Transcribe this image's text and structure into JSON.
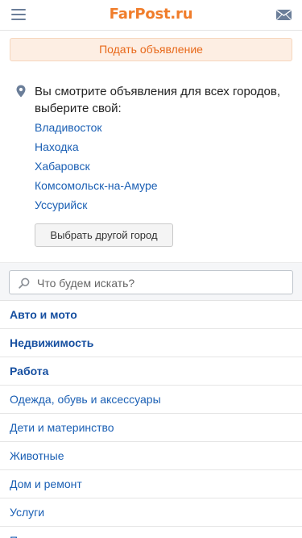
{
  "header": {
    "logo": "FarPost.ru",
    "menu_icon": "hamburger-menu-icon",
    "mail_icon": "envelope-icon"
  },
  "post_ad": {
    "label": "Подать объявление"
  },
  "city_select": {
    "pin_icon": "location-pin-icon",
    "message": "Вы смотрите объявления для всех городов, выберите свой:",
    "cities": [
      "Владивосток",
      "Находка",
      "Хабаровск",
      "Комсомольск-на-Амуре",
      "Уссурийск"
    ],
    "other_city_label": "Выбрать другой город"
  },
  "search": {
    "placeholder": "Что будем искать?",
    "icon": "search-icon"
  },
  "categories": [
    {
      "label": "Авто и мото",
      "bold": true
    },
    {
      "label": "Недвижимость",
      "bold": true
    },
    {
      "label": "Работа",
      "bold": true
    },
    {
      "label": "Одежда, обувь и аксессуары",
      "bold": false
    },
    {
      "label": "Дети и материнство",
      "bold": false
    },
    {
      "label": "Животные",
      "bold": false
    },
    {
      "label": "Дом и ремонт",
      "bold": false
    },
    {
      "label": "Услуги",
      "bold": false
    },
    {
      "label": "Продукты и угощения",
      "bold": false
    }
  ],
  "colors": {
    "brand_orange": "#f07d2b",
    "link_blue": "#1a5fb4",
    "icon_gray": "#6b7e99"
  }
}
